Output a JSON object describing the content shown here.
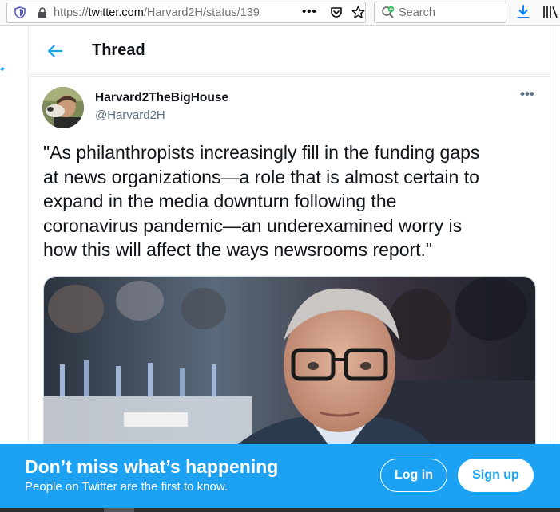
{
  "browser": {
    "url_scheme": "https://",
    "url_host": "twitter.com",
    "url_path": "/Harvard2H/status/139",
    "search_placeholder": "Search",
    "overflow_label": "•••"
  },
  "header": {
    "title": "Thread"
  },
  "tweet": {
    "display_name": "Harvard2TheBigHouse",
    "handle": "@Harvard2H",
    "more_label": "•••",
    "text": "\"As philanthropists increasingly fill in the funding gaps\nat news organizations—a role that is almost certain to\nexpand in the media downturn following the\ncoronavirus pandemic—an underexamined worry is\nhow this will affect the ways newsrooms report.\""
  },
  "banner": {
    "title": "Don’t miss what’s happening",
    "subtitle": "People on Twitter are the first to know.",
    "login_label": "Log in",
    "signup_label": "Sign up"
  },
  "colors": {
    "brand": "#1da1f2",
    "text": "#0f1419",
    "secondary": "#5b7083"
  }
}
